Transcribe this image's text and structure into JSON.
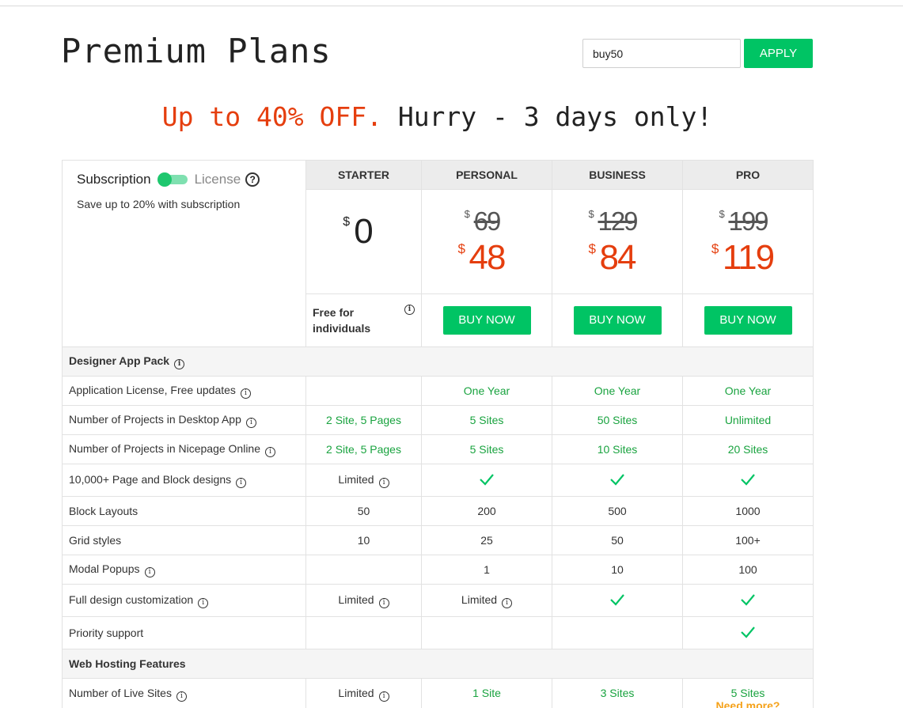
{
  "header": {
    "title": "Premium Plans",
    "coupon_value": "buy50",
    "apply_label": "APPLY"
  },
  "promo": {
    "highlight": "Up to 40% OFF.",
    "rest": " Hurry - 3 days only!"
  },
  "billing": {
    "subscription_label": "Subscription",
    "license_label": "License",
    "help_icon": "question-circle-icon",
    "save_note": "Save up to 20% with subscription"
  },
  "plans": [
    {
      "name": "STARTER",
      "currency": "$",
      "price": "0",
      "free_note": "Free for individuals"
    },
    {
      "name": "PERSONAL",
      "currency": "$",
      "old_price": "69",
      "new_price": "48",
      "buy_label": "BUY NOW"
    },
    {
      "name": "BUSINESS",
      "currency": "$",
      "old_price": "129",
      "new_price": "84",
      "buy_label": "BUY NOW"
    },
    {
      "name": "PRO",
      "currency": "$",
      "old_price": "199",
      "new_price": "119",
      "buy_label": "BUY NOW"
    }
  ],
  "sections": {
    "designer": "Designer App Pack",
    "hosting": "Web Hosting Features"
  },
  "features": [
    {
      "name": "Application License, Free updates",
      "values": [
        "",
        "One Year",
        "One Year",
        "One Year"
      ]
    },
    {
      "name": "Number of Projects in Desktop App",
      "values": [
        "2 Site, 5 Pages",
        "5 Sites",
        "50 Sites",
        "Unlimited"
      ]
    },
    {
      "name": "Number of Projects in Nicepage Online",
      "values": [
        "2 Site, 5 Pages",
        "5 Sites",
        "10 Sites",
        "20 Sites"
      ]
    },
    {
      "name": "10,000+ Page and Block designs",
      "values": [
        "Limited",
        "check",
        "check",
        "check"
      ]
    },
    {
      "name": "Block Layouts",
      "values": [
        "50",
        "200",
        "500",
        "1000"
      ]
    },
    {
      "name": "Grid styles",
      "values": [
        "10",
        "25",
        "50",
        "100+"
      ]
    },
    {
      "name": "Modal Popups",
      "values": [
        "",
        "1",
        "10",
        "100"
      ]
    },
    {
      "name": "Full design customization",
      "values": [
        "Limited",
        "Limited",
        "check",
        "check"
      ]
    },
    {
      "name": "Priority support",
      "values": [
        "",
        "",
        "",
        "check"
      ]
    },
    {
      "name": "Number of Live Sites",
      "values": [
        "Limited",
        "1 Site",
        "3 Sites",
        "5 Sites"
      ],
      "extra": "Need more?"
    }
  ],
  "colors": {
    "accent_green": "#00c464",
    "value_green": "#19a33f",
    "promo_red": "#e53e0e",
    "need_more_orange": "#f5a21b"
  }
}
